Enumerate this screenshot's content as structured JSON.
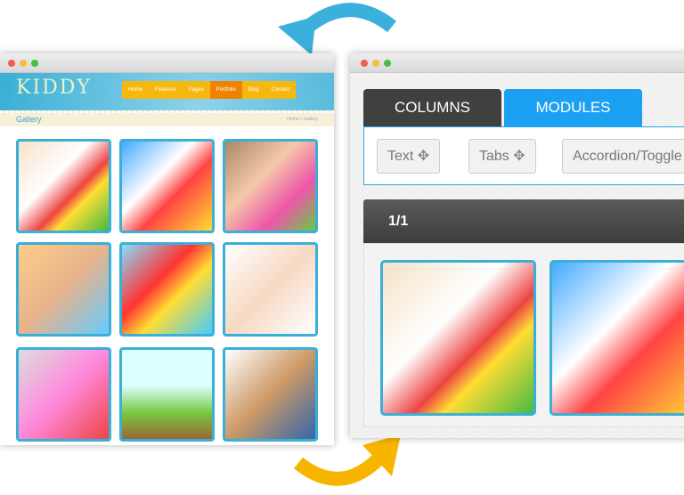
{
  "left_window": {
    "logo": "KIDDY",
    "nav": [
      {
        "label": "Home"
      },
      {
        "label": "Features"
      },
      {
        "label": "Pages"
      },
      {
        "label": "Portfolio",
        "active": true
      },
      {
        "label": "Blog"
      },
      {
        "label": "Contact"
      }
    ],
    "page_title": "Gallery",
    "breadcrumb": "Home » Gallery",
    "gallery_count": 9
  },
  "right_window": {
    "tabs": [
      {
        "label": "COLUMNS"
      },
      {
        "label": "MODULES"
      }
    ],
    "modules": [
      {
        "label": "Text"
      },
      {
        "label": "Tabs"
      },
      {
        "label": "Accordion/Toggle"
      }
    ],
    "row_label": "1/1"
  },
  "colors": {
    "blue_arrow": "#3cb0dc",
    "yellow_arrow": "#f7b500",
    "tab_active": "#1ca0f2",
    "tab_inactive": "#404040"
  }
}
